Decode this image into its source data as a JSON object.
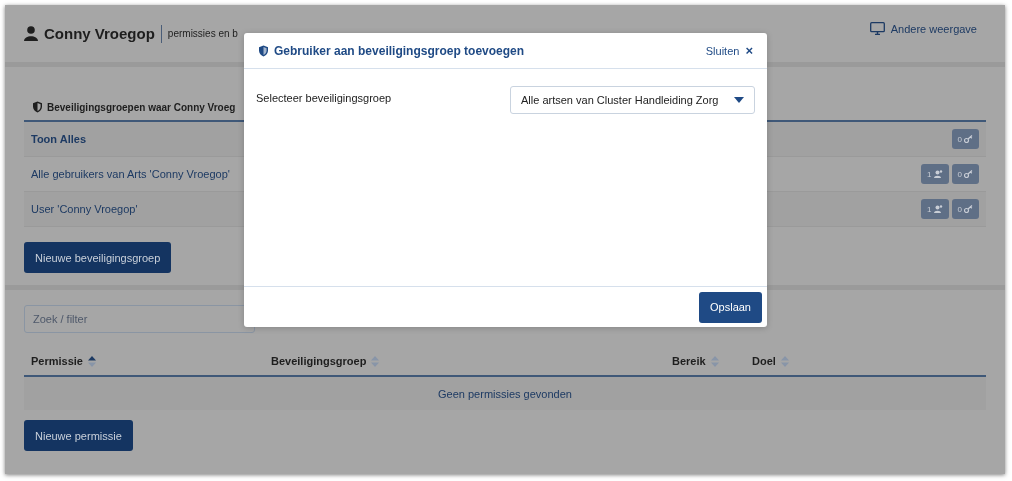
{
  "header": {
    "user_name": "Conny Vroegop",
    "subtitle": "permissies en b",
    "view_switch": "Andere weergave"
  },
  "groups": {
    "title": "Beveiligingsgroepen waar Conny Vroeg",
    "rows": [
      {
        "kind": "all",
        "label": "Toon Alles",
        "badges": [
          {
            "kind": "key",
            "count": "0"
          }
        ]
      },
      {
        "kind": "group",
        "label": "Alle gebruikers van Arts 'Conny Vroegop'",
        "badges": [
          {
            "kind": "users",
            "count": "1"
          },
          {
            "kind": "key",
            "count": "0"
          }
        ]
      },
      {
        "kind": "group",
        "label": "User 'Conny Vroegop'",
        "badges": [
          {
            "kind": "users",
            "count": "1"
          },
          {
            "kind": "key",
            "count": "0"
          }
        ]
      }
    ],
    "new_button": "Nieuwe beveiligingsgroep"
  },
  "permissions": {
    "search": {
      "placeholder": "Zoek / filter"
    },
    "columns": [
      {
        "label": "Permissie",
        "sorted": true
      },
      {
        "label": "Beveiligingsgroep",
        "sorted": false
      },
      {
        "label": "Bereik",
        "sorted": false
      },
      {
        "label": "Doel",
        "sorted": false
      }
    ],
    "empty_message": "Geen permissies gevonden",
    "new_button": "Nieuwe permissie"
  },
  "modal": {
    "title": "Gebruiker aan beveiligingsgroep toevoegen",
    "close": "Sluiten",
    "close_glyph": "×",
    "field_label": "Selecteer beveiligingsgroep",
    "select_value": "Alle artsen van Cluster Handleiding Zorg",
    "save": "Opslaan"
  }
}
